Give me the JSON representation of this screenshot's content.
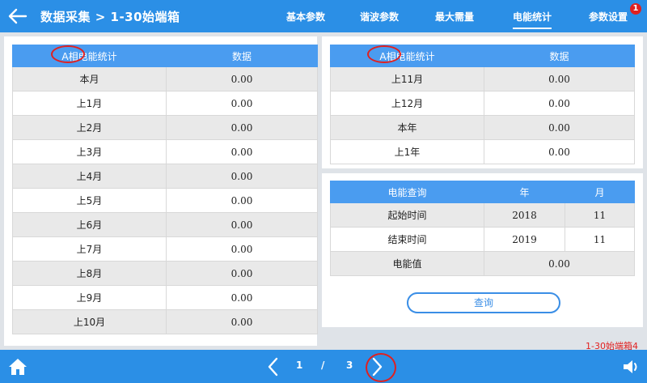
{
  "header": {
    "title": "数据采集  >  1-30始端箱",
    "tabs": [
      {
        "label": "基本参数",
        "active": false
      },
      {
        "label": "谐波参数",
        "active": false
      },
      {
        "label": "最大需量",
        "active": false
      },
      {
        "label": "电能统计",
        "active": true
      },
      {
        "label": "参数设置",
        "active": false
      }
    ],
    "badge_count": "1",
    "accent_color": "#2b8fe6"
  },
  "left_table": {
    "headers": [
      "A相电能统计",
      "数据"
    ],
    "rows": [
      {
        "label": "本月",
        "value": "0.00"
      },
      {
        "label": "上1月",
        "value": "0.00"
      },
      {
        "label": "上2月",
        "value": "0.00"
      },
      {
        "label": "上3月",
        "value": "0.00"
      },
      {
        "label": "上4月",
        "value": "0.00"
      },
      {
        "label": "上5月",
        "value": "0.00"
      },
      {
        "label": "上6月",
        "value": "0.00"
      },
      {
        "label": "上7月",
        "value": "0.00"
      },
      {
        "label": "上8月",
        "value": "0.00"
      },
      {
        "label": "上9月",
        "value": "0.00"
      },
      {
        "label": "上10月",
        "value": "0.00"
      }
    ]
  },
  "right_table": {
    "headers": [
      "A相电能统计",
      "数据"
    ],
    "rows": [
      {
        "label": "上11月",
        "value": "0.00"
      },
      {
        "label": "上12月",
        "value": "0.00"
      },
      {
        "label": "本年",
        "value": "0.00"
      },
      {
        "label": "上1年",
        "value": "0.00"
      }
    ]
  },
  "query": {
    "headers": [
      "电能查询",
      "年",
      "月"
    ],
    "start": {
      "label": "起始时间",
      "year": "2018",
      "month": "11"
    },
    "end": {
      "label": "结束时间",
      "year": "2019",
      "month": "11"
    },
    "energy": {
      "label": "电能值",
      "value": "0.00"
    },
    "button_label": "查询"
  },
  "footer_note": "1-30始端箱4",
  "pagination": {
    "current": "1",
    "separator": "/",
    "total": "3"
  },
  "icons": {
    "back": "back-arrow-icon",
    "home": "home-icon",
    "prev": "chevron-left-icon",
    "next": "chevron-right-icon",
    "sound": "speaker-icon"
  }
}
